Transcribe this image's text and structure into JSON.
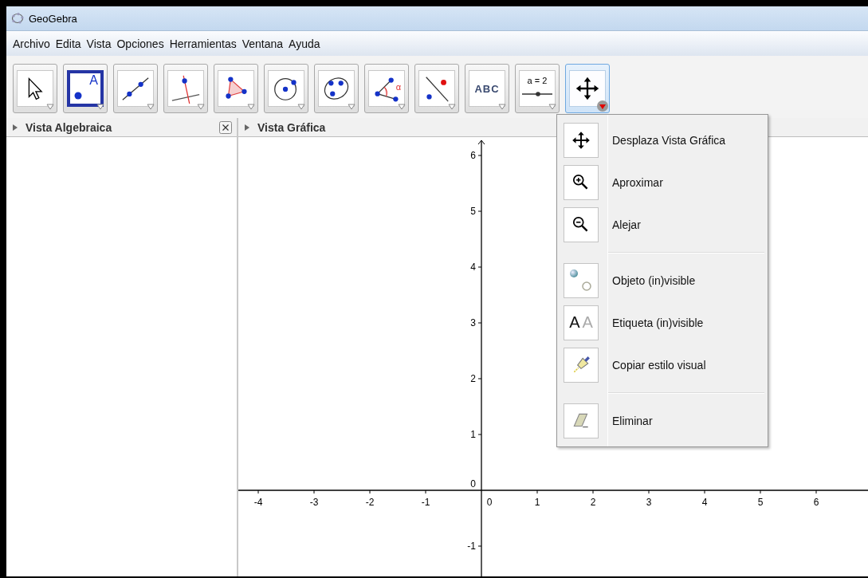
{
  "window": {
    "title": "GeoGebra"
  },
  "menu": [
    "Archivo",
    "Edita",
    "Vista",
    "Opciones",
    "Herramientas",
    "Ventana",
    "Ayuda"
  ],
  "toolbar": [
    {
      "kind": "move",
      "selected": false,
      "expanded": false
    },
    {
      "kind": "point",
      "label": "A",
      "selected": true,
      "expanded": false
    },
    {
      "kind": "line",
      "selected": false,
      "expanded": false
    },
    {
      "kind": "perpendicular",
      "selected": false,
      "expanded": false
    },
    {
      "kind": "polygon",
      "selected": false,
      "expanded": false
    },
    {
      "kind": "circle",
      "selected": false,
      "expanded": false
    },
    {
      "kind": "conic",
      "selected": false,
      "expanded": false
    },
    {
      "kind": "angle",
      "label": "α",
      "selected": false,
      "expanded": false
    },
    {
      "kind": "reflect",
      "selected": false,
      "expanded": false
    },
    {
      "kind": "text",
      "label": "ABC",
      "selected": false,
      "expanded": false
    },
    {
      "kind": "slider",
      "label": "a = 2",
      "selected": false,
      "expanded": false
    },
    {
      "kind": "pan",
      "selected": false,
      "expanded": true
    }
  ],
  "algebra_view": {
    "title": "Vista Algebraica"
  },
  "graphics_view": {
    "title": "Vista Gráfica",
    "x_axis_labels": [
      "-4",
      "-3",
      "-2",
      "-1",
      "0",
      "1",
      "2",
      "3",
      "4",
      "5",
      "6"
    ],
    "y_axis_labels": [
      "6",
      "5",
      "4",
      "3",
      "2",
      "1",
      "0",
      "-1"
    ]
  },
  "tool_menu": {
    "groups": [
      [
        {
          "kind": "pan",
          "label": "Desplaza Vista Gráfica"
        },
        {
          "kind": "zoom-in",
          "label": "Aproximar"
        },
        {
          "kind": "zoom-out",
          "label": "Alejar"
        }
      ],
      [
        {
          "kind": "show-object",
          "label": "Objeto (in)visible"
        },
        {
          "kind": "show-label",
          "label": "Etiqueta (in)visible",
          "icon_letters": [
            "A",
            "A"
          ]
        },
        {
          "kind": "copy-style",
          "label": "Copiar estilo visual"
        }
      ],
      [
        {
          "kind": "delete",
          "label": "Eliminar"
        }
      ]
    ]
  }
}
